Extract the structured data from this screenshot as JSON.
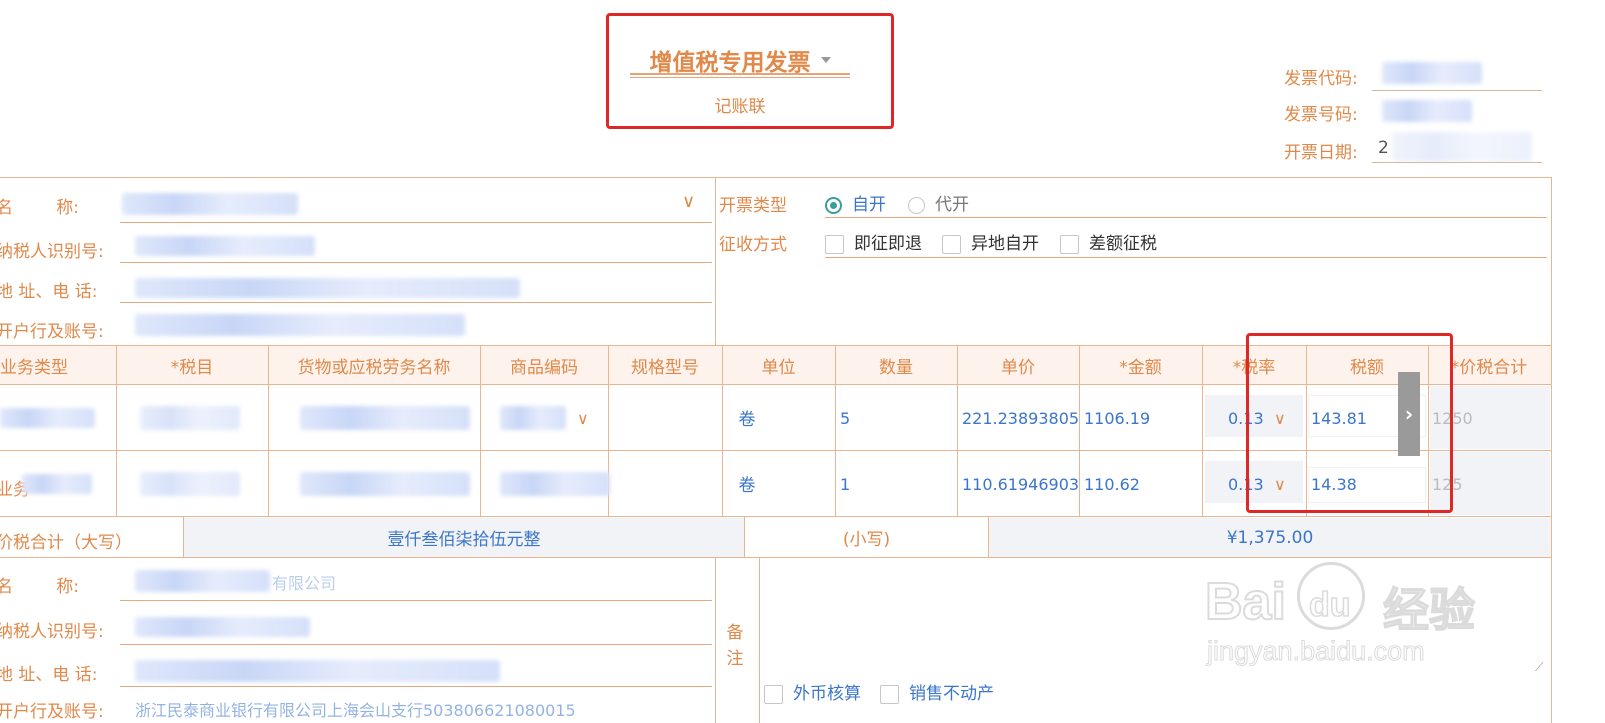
{
  "invoice_type": "增值税专用发票",
  "invoice_copy": "记账联",
  "meta": {
    "code_label": "发票代码:",
    "number_label": "发票号码:",
    "date_label": "开票日期:",
    "date_value": "2"
  },
  "buyer": {
    "name_label": "名        称:",
    "taxid_label": "纳税人识别号:",
    "addr_label": "地 址、电 话:",
    "bank_label": "开户行及账号:"
  },
  "issue": {
    "type_label": "开票类型",
    "opt_self": "自开",
    "opt_agent": "代开",
    "method_label": "征收方式",
    "m1": "即征即退",
    "m2": "异地自开",
    "m3": "差额征税"
  },
  "table": {
    "headers": [
      "业务类型",
      "*税目",
      "货物或应税劳务名称",
      "商品编码",
      "规格型号",
      "单位",
      "数量",
      "单价",
      "*金额",
      "*税率",
      "税额",
      "*价税合计"
    ],
    "rows": [
      {
        "unit": "卷",
        "qty": "5",
        "price": "221.23893805",
        "amount": "1106.19",
        "rate": "0.13",
        "tax": "143.81",
        "total": "1250"
      },
      {
        "unit": "卷",
        "qty": "1",
        "price": "110.61946903",
        "amount": "110.62",
        "rate": "0.13",
        "tax": "14.38",
        "total": "125"
      }
    ],
    "row2_type": "业务"
  },
  "totals": {
    "upper_label": "价税合计（大写）",
    "upper_value": "壹仟叁佰柒拾伍元整",
    "lower_label": "(小写)",
    "lower_value": "¥1,375.00"
  },
  "seller": {
    "name_label": "名        称:",
    "name_value_tail": "有限公司",
    "taxid_label": "纳税人识别号:",
    "addr_label": "地 址、电 话:",
    "bank_label": "开户行及账号:",
    "bank_value": "浙江民泰商业银行有限公司上海会山支行503806621080015"
  },
  "remarks": {
    "label": "备注",
    "opt1": "外币核算",
    "opt2": "销售不动产"
  },
  "watermark": {
    "brand": "Bai",
    "brand2": "du",
    "cn": "经验",
    "url": "jingyan.baidu.com"
  },
  "colors": {
    "accent": "#e0894a",
    "highlight": "#e02727",
    "value": "#3b76c9"
  }
}
